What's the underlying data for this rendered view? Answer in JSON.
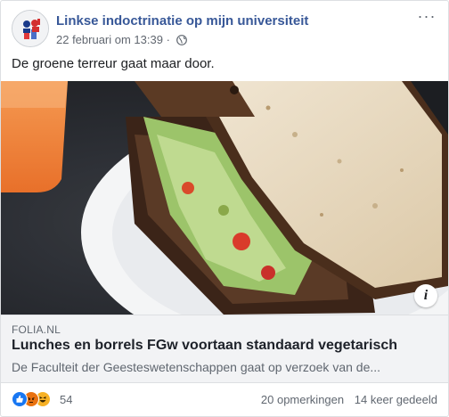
{
  "post": {
    "page_name": "Linkse indoctrinatie op mijn universiteit",
    "timestamp": "22 februari om 13:39",
    "separator": "·",
    "privacy_icon": "globe-icon",
    "text": "De groene terreur gaat maar door."
  },
  "link": {
    "domain": "FOLIA.NL",
    "title": "Lunches en borrels FGw voortaan standaard vegetarisch",
    "description": "De Faculteit der Geesteswetenschappen gaat op verzoek van de..."
  },
  "footer": {
    "reaction_icons": [
      "like-icon",
      "angry-icon",
      "haha-icon"
    ],
    "reaction_count": "54",
    "comments": "20 opmerkingen",
    "shares": "14 keer gedeeld"
  },
  "colors": {
    "page_name": "#385898",
    "like": "#1877f2",
    "angry": "#e9710f",
    "haha": "#f7b125"
  }
}
